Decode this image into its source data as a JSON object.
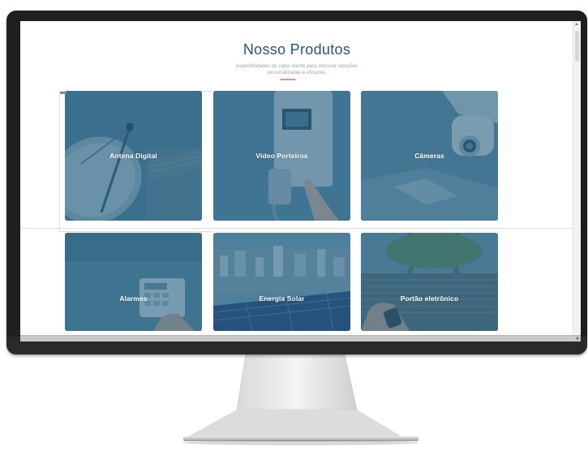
{
  "page": {
    "title": "Nosso Produtos",
    "subtitle_line1": "especificidades de cada cliente para oferecer soluções",
    "subtitle_line2": "personalizadas e eficazes."
  },
  "colors": {
    "title": "#27557a",
    "accent_underline": "#e08fae",
    "card_overlay": "#296283",
    "monitor": "#1f1f1f"
  },
  "products": [
    {
      "label": "Antena Digital",
      "icon": "satellite-dish-image"
    },
    {
      "label": "Video Porteiros",
      "icon": "video-intercom-image"
    },
    {
      "label": "Câmeras",
      "icon": "security-camera-image"
    },
    {
      "label": "Alarmes",
      "icon": "alarm-keypad-image"
    },
    {
      "label": "Energia Solar",
      "icon": "solar-panels-image"
    },
    {
      "label": "Portão eletrônico",
      "icon": "gate-remote-image"
    }
  ]
}
